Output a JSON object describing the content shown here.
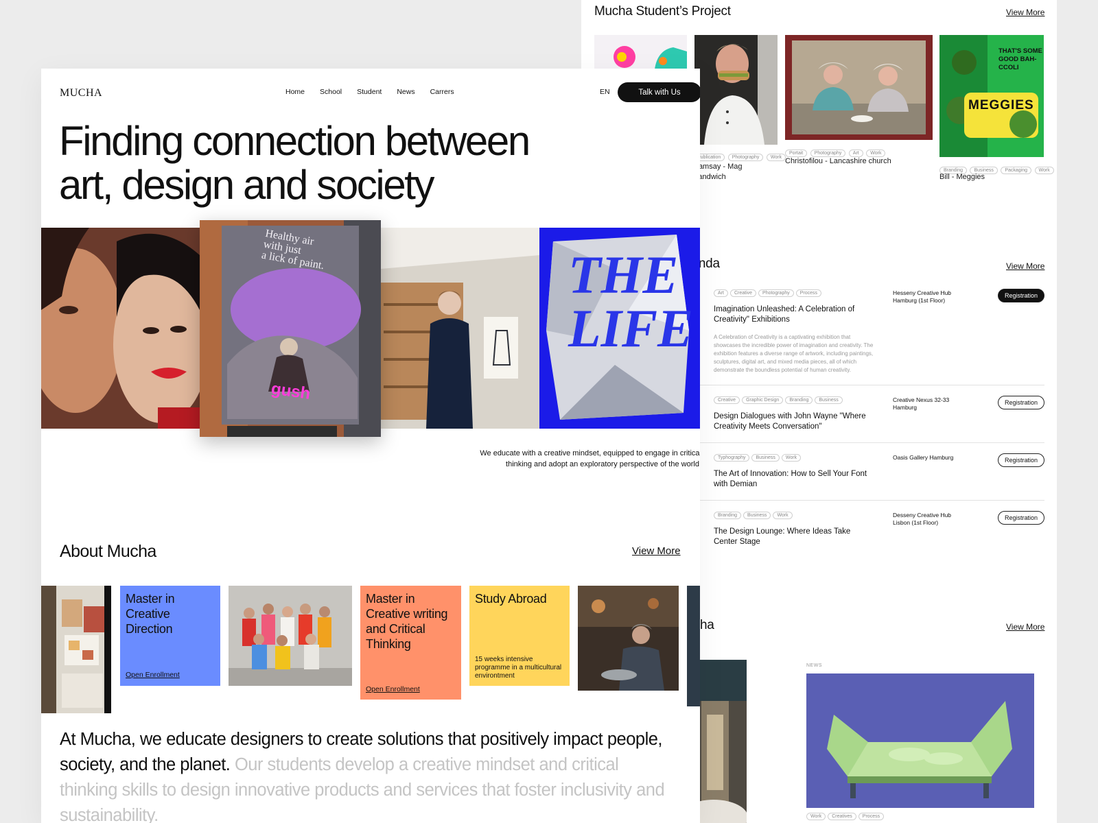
{
  "projects": {
    "title": "Mucha Student’s Project",
    "view_more": "View More",
    "items": [
      {
        "tags": [
          "Publication",
          "Photography",
          "Work"
        ],
        "caption": "Ramsay - Mag Sandwich"
      },
      {
        "tags": [
          "Portait",
          "Photography",
          "Art",
          "Work"
        ],
        "caption": "Christofilou - Lancashire church"
      },
      {
        "tags": [
          "Branding",
          "Business",
          "Packaging",
          "Work"
        ],
        "caption": "Bill - Meggies",
        "poster_text": "THAT'S SOME GOOD BAH-CCOLI",
        "product_text": "MEGGIES"
      }
    ]
  },
  "agenda": {
    "title": "Agenda",
    "view_more": "View More",
    "events": [
      {
        "tags": [
          "Art",
          "Creative",
          "Photography",
          "Process"
        ],
        "title": "Imagination Unleashed: A Celebration of Creativity\" Exhibitions",
        "description": "A Celebration of Creativity is a captivating exhibition that showcases the incredible power of imagination and creativity. The exhibition features a diverse range of artwork, including paintings, sculptures, digital art, and mixed media pieces, all of which demonstrate the boundless potential of human creativity.",
        "place_line1": "Hesseny Creative Hub",
        "place_line2": "Hamburg (1st Floor)",
        "button": "Registration"
      },
      {
        "tags": [
          "Creative",
          "Graphic Design",
          "Branding",
          "Business"
        ],
        "title": "Design Dialogues with John Wayne \"Where Creativity Meets Conversation\"",
        "place_line1": "Creative Nexus 32-33",
        "place_line2": "Hamburg",
        "button": "Registration"
      },
      {
        "tags": [
          "Typhography",
          "Business",
          "Work"
        ],
        "title": "The Art of Innovation: How to Sell Your Font with Demian",
        "place_line1": "Oasis Gallery Hamburg",
        "place_line2": "",
        "button": "Registration"
      },
      {
        "tags": [
          "Branding",
          "Business",
          "Work"
        ],
        "title": "The Design Lounge: Where Ideas Take Center Stage",
        "place_line1": "Desseny Creative Hub",
        "place_line2": "Lisbon (1st Floor)",
        "button": "Registration"
      }
    ]
  },
  "news": {
    "title": "Mucha",
    "view_more": "View More",
    "label": "NEWS",
    "tags": [
      "Work",
      "Creatives",
      "Process"
    ]
  },
  "front": {
    "logo": "MUCHA",
    "nav": [
      "Home",
      "School",
      "Student",
      "News",
      "Carrers"
    ],
    "lang": "EN",
    "cta": "Talk with Us",
    "hero_line1": "Finding connection between",
    "hero_line2": "art, design and society",
    "billboard_line1": "Healthy air",
    "billboard_line2": "with just",
    "billboard_line3": "a lick of paint.",
    "billboard_brand": "gush",
    "poster_text": "THE",
    "poster_text2": "LIFE",
    "intro_line1": "We educate  with a creative mindset, equipped to engage in critical",
    "intro_line2": "thinking and adopt an exploratory perspective of the world.",
    "about_title": "About Mucha",
    "about_more": "View More",
    "programs": [
      {
        "title": "Master in Creative Direction",
        "link": "Open Enrollment"
      },
      {
        "title": "Master in Creative writing and Critical Thinking",
        "link": "Open Enrollment"
      },
      {
        "title": "Study Abroad",
        "note": "15 weeks intensive programme in a multicultural environtment"
      }
    ],
    "statement_dark": "At Mucha, we educate designers to create solutions that positively impact people, society, and the planet.",
    "statement_light": "Our students develop a creative mindset and critical thinking skills to design innovative products and services that foster inclusivity and sustainability."
  },
  "colors": {
    "blue_card": "#6a8cff",
    "orange_card": "#ff916a",
    "yellow_card": "#ffd55b",
    "poster_blue": "#1b1be8",
    "news_purple": "#5a5fb4",
    "meggies_green": "#25b34a"
  }
}
